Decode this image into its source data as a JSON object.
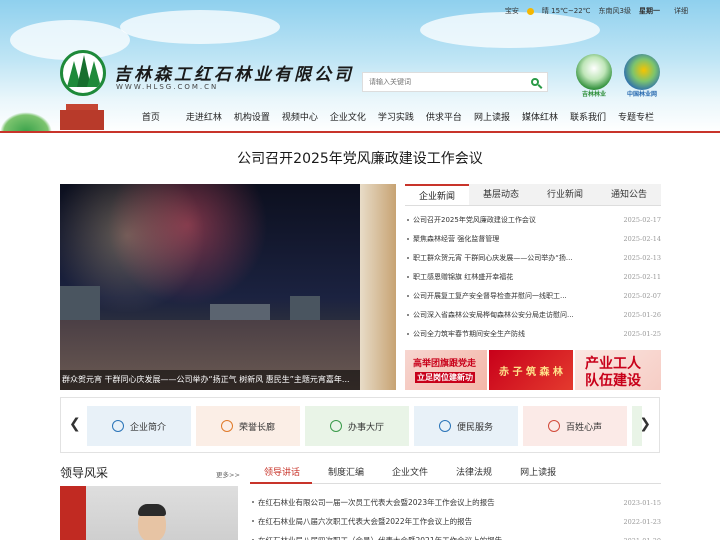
{
  "topbar": {
    "city": "宝安",
    "weather": "晴 15℃~22℃",
    "wind": "东南风3级",
    "weekday": "星期一",
    "more": "详细"
  },
  "brand": {
    "name": "吉林森工红石林业有限公司",
    "url": "WWW.HLSG.COM.CN"
  },
  "search": {
    "placeholder": "请输入关键词"
  },
  "partners": [
    {
      "label": "吉林林业",
      "color": "#2f8f3a"
    },
    {
      "label": "中国林业网",
      "color": "#2a6bb0"
    }
  ],
  "nav": [
    "首页",
    "走进红林",
    "机构设置",
    "视频中心",
    "企业文化",
    "学习实践",
    "供求平台",
    "网上读报",
    "媒体红林",
    "联系我们",
    "专题专栏"
  ],
  "headline": "公司召开2025年党风廉政建设工作会议",
  "slider": {
    "caption": "群众贺元宵 干群同心庆发展——公司举办“扬正气 树新风 惠民生”主题元宵嘉年..."
  },
  "news": {
    "tabs": [
      "企业新闻",
      "基层动态",
      "行业新闻",
      "通知公告"
    ],
    "items": [
      {
        "title": "公司召开2025年党风廉政建设工作会议",
        "date": "2025-02-17"
      },
      {
        "title": "聚焦森林经营 强化监督管理",
        "date": "2025-02-14"
      },
      {
        "title": "职工群众贺元宵 干群同心庆发展——公司举办“扬...",
        "date": "2025-02-13"
      },
      {
        "title": "职工感恩赠锦旗 红林盛开幸福花",
        "date": "2025-02-11"
      },
      {
        "title": "公司开展复工复产安全督导检查并慰问一线职工...",
        "date": "2025-02-07"
      },
      {
        "title": "公司深入省森林公安局桦甸森林公安分局走访慰问...",
        "date": "2025-01-26"
      },
      {
        "title": "公司全力筑牢春节期间安全生产防线",
        "date": "2025-01-25"
      }
    ]
  },
  "banners": [
    {
      "line1": "高举团旗跟党走",
      "line2": "立足岗位建新功"
    },
    {
      "line1": "赤 子 筑 森 林"
    },
    {
      "line1": "产业工人",
      "line2": "队伍建设"
    }
  ],
  "quick_links": [
    {
      "label": "企业简介",
      "icon": "book-icon",
      "color": "#2a74b8"
    },
    {
      "label": "荣誉长廊",
      "icon": "trophy-icon",
      "color": "#e07a2a"
    },
    {
      "label": "办事大厅",
      "icon": "people-icon",
      "color": "#3a9a4a"
    },
    {
      "label": "便民服务",
      "icon": "handshake-icon",
      "color": "#2a74b8"
    },
    {
      "label": "百姓心声",
      "icon": "chat-icon",
      "color": "#d24a3a"
    }
  ],
  "leaders": {
    "title": "领导风采",
    "more": "更多>>"
  },
  "documents": {
    "tabs": [
      "领导讲话",
      "制度汇编",
      "企业文件",
      "法律法规",
      "网上读报"
    ],
    "items": [
      {
        "title": "在红石林业有限公司一届一次员工代表大会暨2023年工作会议上的报告",
        "date": "2023-01-15"
      },
      {
        "title": "在红石林业局八届六次职工代表大会暨2022年工作会议上的报告",
        "date": "2022-01-23"
      },
      {
        "title": "在红石林业局八届四次职工（会员）代表大会暨2021年工作会议上的报告",
        "date": "2021-01-20"
      }
    ]
  }
}
